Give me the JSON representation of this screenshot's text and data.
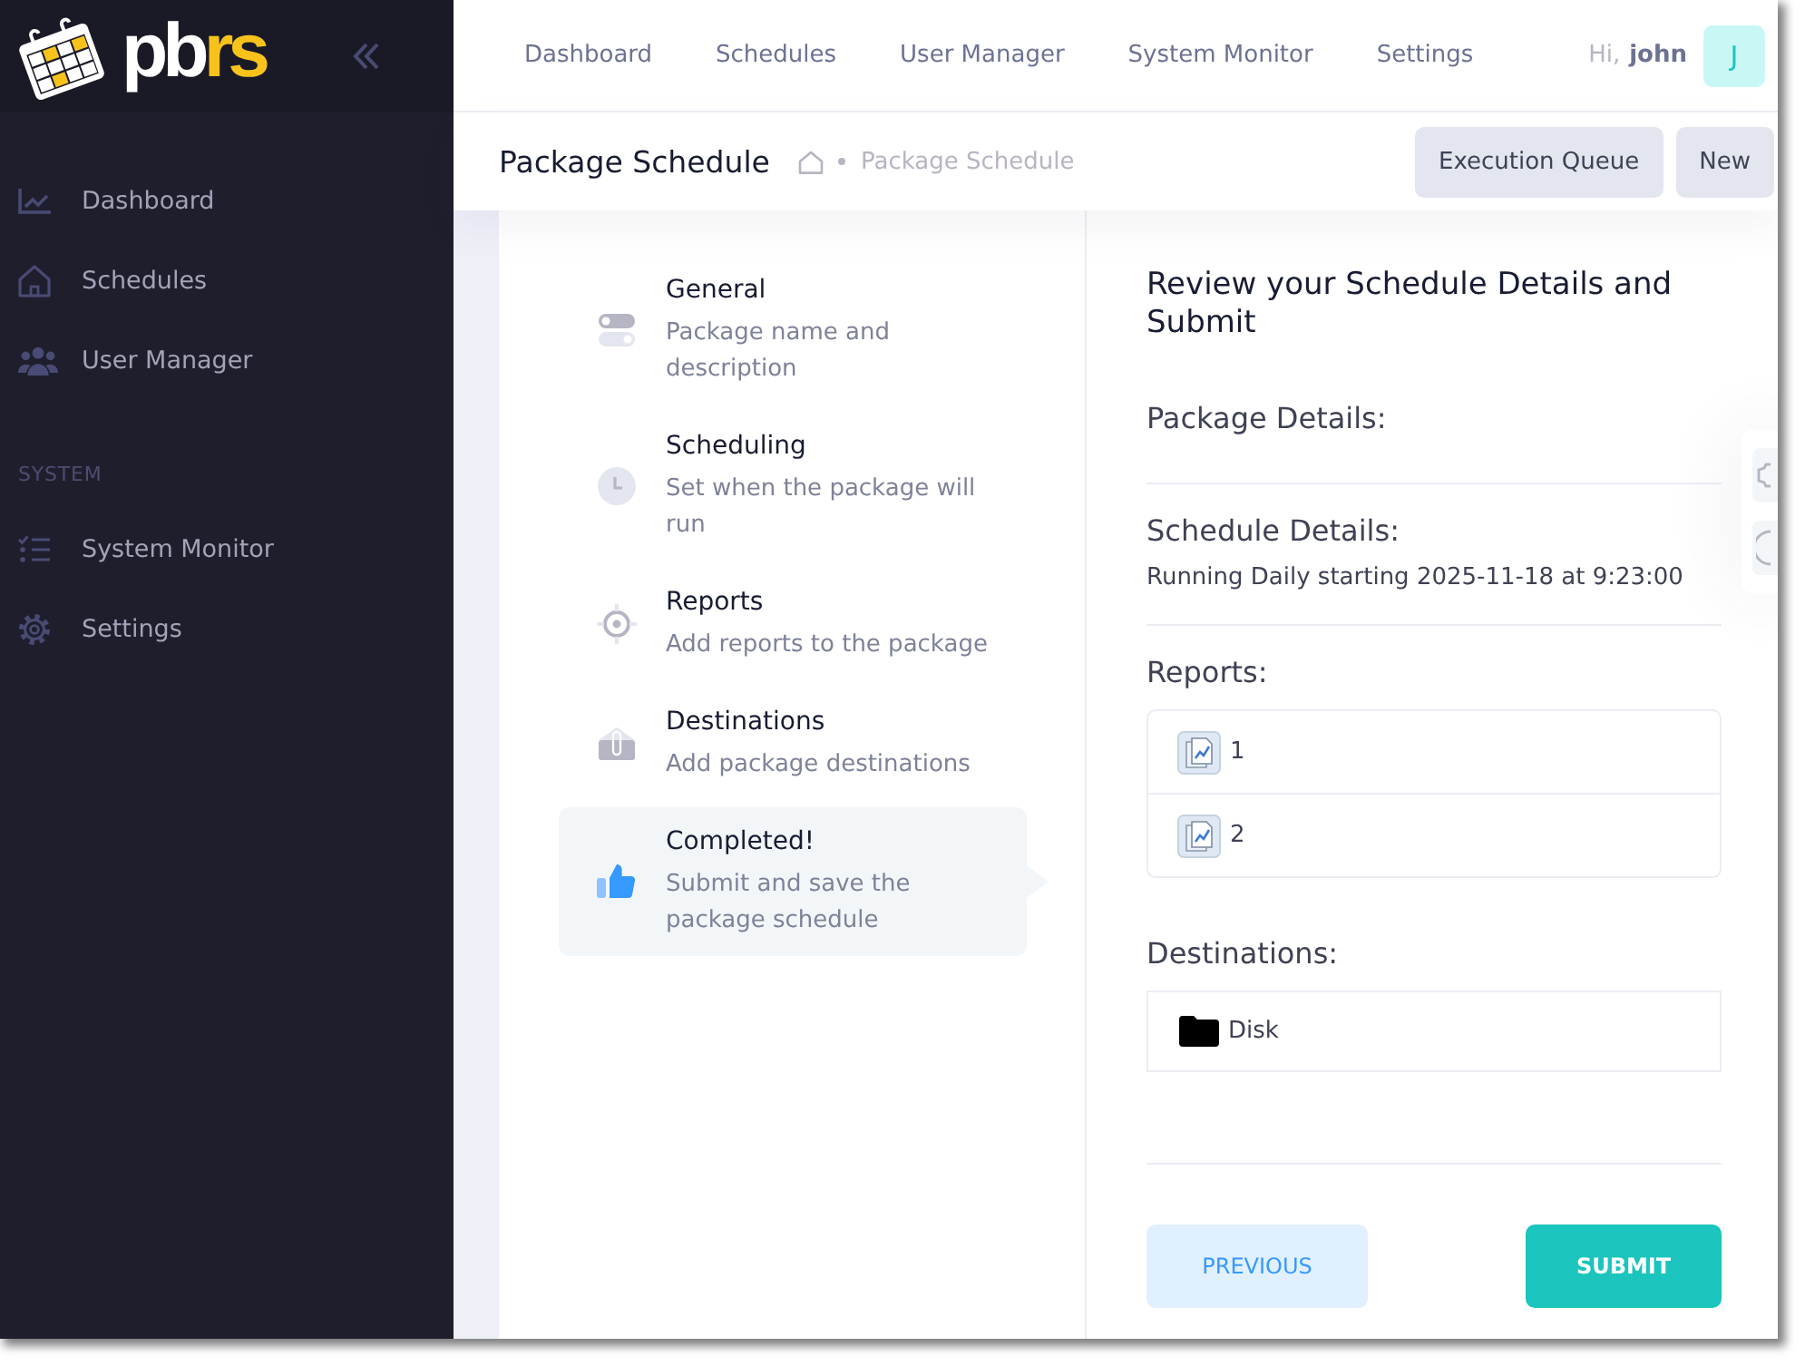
{
  "sidebar": {
    "logo": {
      "parts": [
        {
          "text": "pb",
          "color": "#ffffff"
        },
        {
          "text": "rs",
          "color": "#f7c31b"
        }
      ]
    },
    "groups": [
      {
        "items": [
          {
            "label": "Dashboard",
            "selected": false
          },
          {
            "label": "Schedules",
            "selected": false
          },
          {
            "label": "User Manager",
            "selected": false
          }
        ]
      },
      {
        "heading": "SYSTEM",
        "items": [
          {
            "label": "System Monitor",
            "selected": false
          },
          {
            "label": "Settings",
            "selected": false
          }
        ]
      }
    ]
  },
  "topbar": {
    "nav": [
      {
        "label": "Dashboard",
        "selected": false
      },
      {
        "label": "Schedules",
        "selected": false
      },
      {
        "label": "User Manager",
        "selected": false
      },
      {
        "label": "System Monitor",
        "selected": false
      },
      {
        "label": "Settings",
        "selected": false
      }
    ],
    "user": {
      "greeting": "Hi,",
      "name": "john",
      "initial": "J"
    }
  },
  "subheader": {
    "title": "Package Schedule",
    "breadcrumb": [
      "Package Schedule"
    ],
    "buttons": [
      "Execution Queue",
      "New"
    ]
  },
  "wizard": {
    "steps": [
      {
        "title": "General",
        "description": "Package name and description",
        "selected": false
      },
      {
        "title": "Scheduling",
        "description": "Set when the package will run",
        "selected": false
      },
      {
        "title": "Reports",
        "description": "Add reports to the package",
        "selected": false
      },
      {
        "title": "Destinations",
        "description": "Add package destinations",
        "selected": false
      },
      {
        "title": "Completed!",
        "description": "Submit and save the package schedule",
        "selected": true
      }
    ],
    "review": {
      "heading": "Review your Schedule Details and Submit",
      "package_details": {
        "label": "Package Details:"
      },
      "schedule_details": {
        "label": "Schedule Details:",
        "text": "Running Daily starting 2025-11-18 at 9:23:00"
      },
      "reports": {
        "label": "Reports:",
        "items": [
          "1",
          "2"
        ]
      },
      "destinations": {
        "label": "Destinations:",
        "items": [
          "Disk"
        ]
      }
    },
    "buttons": {
      "previous": "PREVIOUS",
      "submit": "SUBMIT"
    }
  }
}
